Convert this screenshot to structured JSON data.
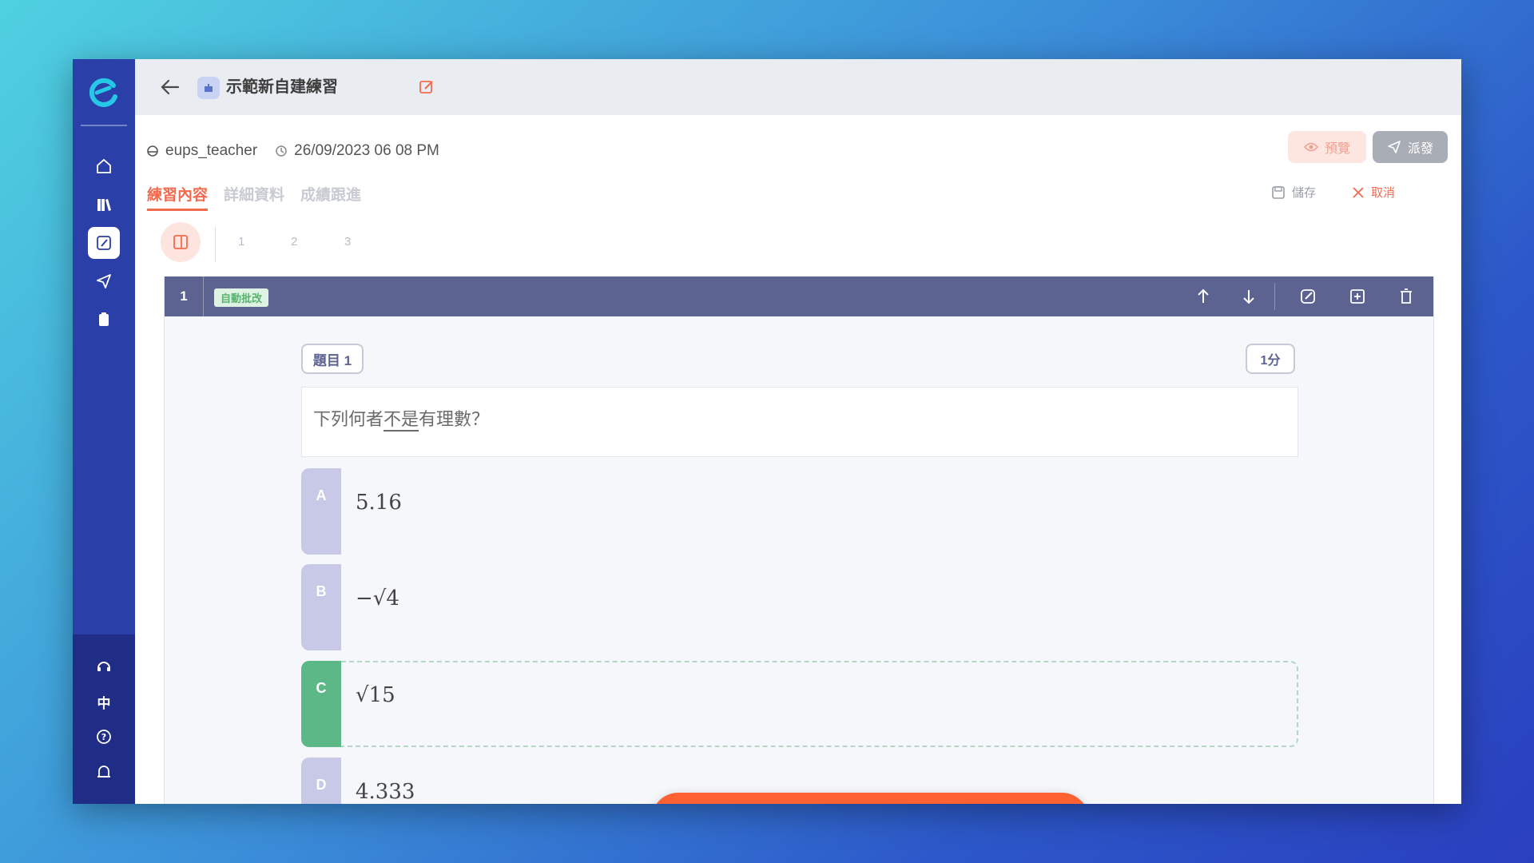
{
  "header": {
    "title": "示範新自建練習"
  },
  "meta": {
    "author": "eups_teacher",
    "datetime": "26/09/2023 06 08 PM"
  },
  "actions": {
    "preview_label": "預覽",
    "send_label": "派發",
    "save_label": "儲存",
    "cancel_label": "取消"
  },
  "tabs": [
    {
      "label": "練習內容",
      "active": true
    },
    {
      "label": "詳細資料",
      "active": false
    },
    {
      "label": "成績跟進",
      "active": false
    }
  ],
  "question_nav": [
    "1",
    "2",
    "3"
  ],
  "question": {
    "number": "1",
    "tag": "自動批改",
    "label": "題目 1",
    "score": "1分",
    "text_before": "下列何者",
    "text_underline": "不是",
    "text_after": "有理數？",
    "options": [
      {
        "letter": "A",
        "text": "5.16",
        "correct": false
      },
      {
        "letter": "B",
        "text": "−√4",
        "correct": false
      },
      {
        "letter": "C",
        "text": "√15",
        "correct": true
      },
      {
        "letter": "D",
        "text": "4.333",
        "correct": false
      }
    ]
  },
  "sidebar": {
    "language_label": "中"
  },
  "colors": {
    "sidebar": "#2a3fa8",
    "accent": "#f26b4f",
    "question_header": "#5c6390",
    "correct": "#5cb987",
    "toolbar": "#ff6232"
  }
}
